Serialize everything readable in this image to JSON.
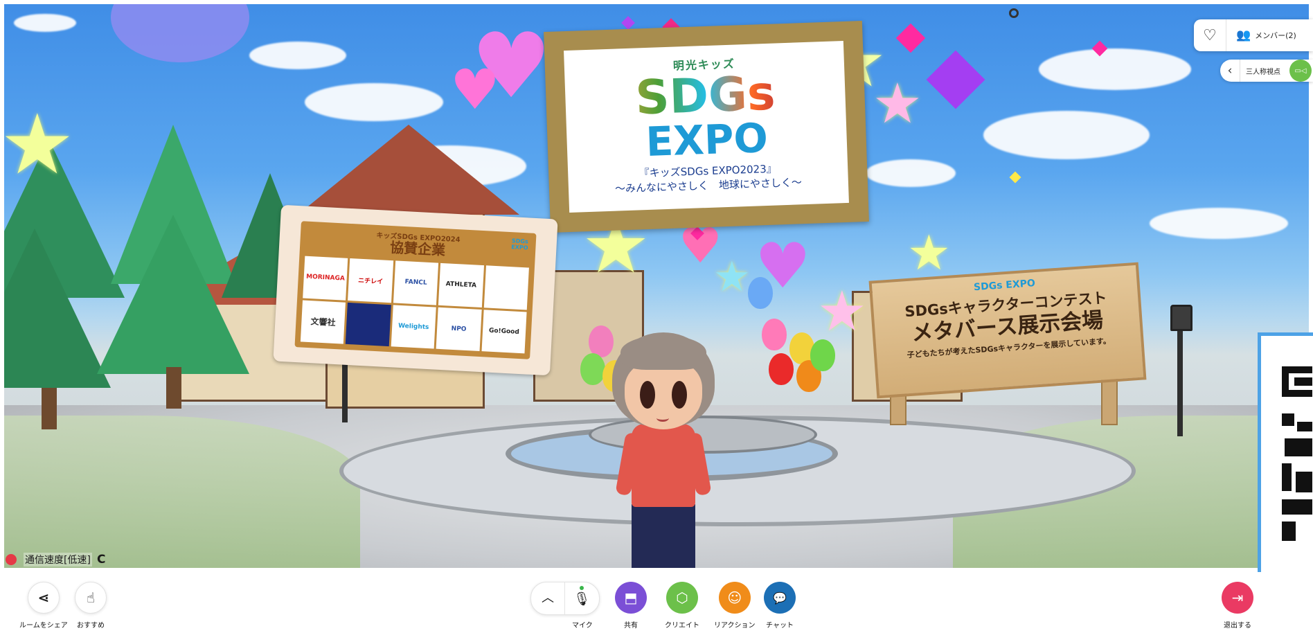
{
  "scene": {
    "main_board": {
      "brand": "明光キッズ",
      "logo_line1": "SDGs",
      "logo_line2": "EXPO",
      "subtitle1": "『キッズSDGs EXPO2023』",
      "subtitle2": "〜みんなにやさしく　地球にやさしく〜"
    },
    "sponsor_board": {
      "heading": "キッズSDGs EXPO2024",
      "title": "協賛企業",
      "corner_logo": "SDGs EXPO",
      "sponsors": [
        "MORINAGA",
        "ニチレイ",
        "FANCL",
        "ATHLETA",
        "",
        "文響社",
        "",
        "Welights",
        "NPO",
        "Go!Good"
      ]
    },
    "wood_sign": {
      "logo": "SDGs EXPO",
      "line1": "SDGsキャラクターコンテスト",
      "line2": "メタバース展示会場",
      "line3": "子どもたちが考えたSDGsキャラクターを展示しています。"
    }
  },
  "status": {
    "connection_text": "通信速度[低速]",
    "reload_glyph": "C"
  },
  "top_right": {
    "heart_icon": "♡",
    "members_icon": "👥",
    "members_label": "メンバー(2)"
  },
  "viewpoint": {
    "chevron": "‹",
    "label": "三人称視点",
    "camera_icon": "▭◁"
  },
  "toolbar": {
    "share": {
      "icon": "⋖",
      "label": "ルームをシェア"
    },
    "recommend": {
      "icon": "☝",
      "label": "おすすめ"
    },
    "mic": {
      "chevron": "︿",
      "icon": "🎙",
      "label": "マイク"
    },
    "share_screen": {
      "icon": "⬒",
      "label": "共有",
      "color": "#7b4fd6"
    },
    "create": {
      "icon": "⬡",
      "label": "クリエイト",
      "color": "#6cc04a"
    },
    "reaction": {
      "icon": "☺",
      "label": "リアクション",
      "color": "#f08c1a"
    },
    "chat": {
      "icon": "💬",
      "label": "チャット",
      "color": "#1c6fb5"
    },
    "exit": {
      "icon": "⇥",
      "label": "退出する",
      "color": "#ea3a63"
    }
  }
}
